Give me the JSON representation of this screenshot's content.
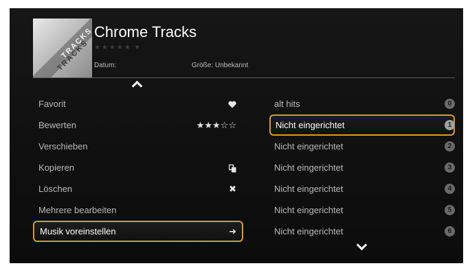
{
  "header": {
    "title": "Chrome Tracks",
    "rating_stars": "★★★★★ ♥",
    "art_text": "TRACKS",
    "datum_label": "Datum:",
    "size_label": "Größe: Unbekannt"
  },
  "menu": {
    "items": [
      {
        "label": "Favorit",
        "right": ""
      },
      {
        "label": "Bewerten",
        "right": "★★★☆☆"
      },
      {
        "label": "Verschieben",
        "right": ""
      },
      {
        "label": "Kopieren",
        "right": ""
      },
      {
        "label": "Löschen",
        "right": "✖"
      },
      {
        "label": "Mehrere bearbeiten",
        "right": ""
      },
      {
        "label": "Musik voreinstellen",
        "right": "➜"
      }
    ],
    "selected_index": 6
  },
  "presets": {
    "items": [
      {
        "label": "alt hits",
        "num": "0"
      },
      {
        "label": "Nicht eingerichtet",
        "num": "1"
      },
      {
        "label": "Nicht eingerichtet",
        "num": "2"
      },
      {
        "label": "Nicht eingerichtet",
        "num": "3"
      },
      {
        "label": "Nicht eingerichtet",
        "num": "4"
      },
      {
        "label": "Nicht eingerichtet",
        "num": "5"
      },
      {
        "label": "Nicht eingerichtet",
        "num": "6"
      }
    ],
    "selected_index": 1
  },
  "colors": {
    "accent": "#e0962c",
    "background": "#0e0e0e"
  }
}
